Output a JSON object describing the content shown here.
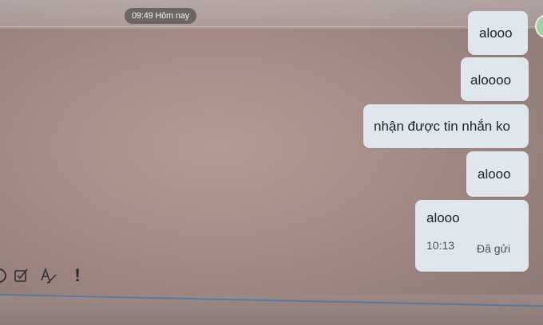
{
  "timestamp_divider": "09:49 Hôm nay",
  "messages": [
    {
      "text": "alooo"
    },
    {
      "text": "aloooo"
    },
    {
      "text": "nhận được tin nhắn ko"
    },
    {
      "text": "alooo"
    },
    {
      "text": "alooo",
      "time": "10:13",
      "status": "Đã gửi"
    }
  ],
  "toolbar": {
    "icons": [
      "partial-circle-icon",
      "checkbox-icon",
      "text-format-icon",
      "exclamation-icon"
    ],
    "important_glyph": "!"
  },
  "colors": {
    "bubble": "#dfe6ee",
    "pill": "#6b6565",
    "input_line": "#4f74a6"
  }
}
